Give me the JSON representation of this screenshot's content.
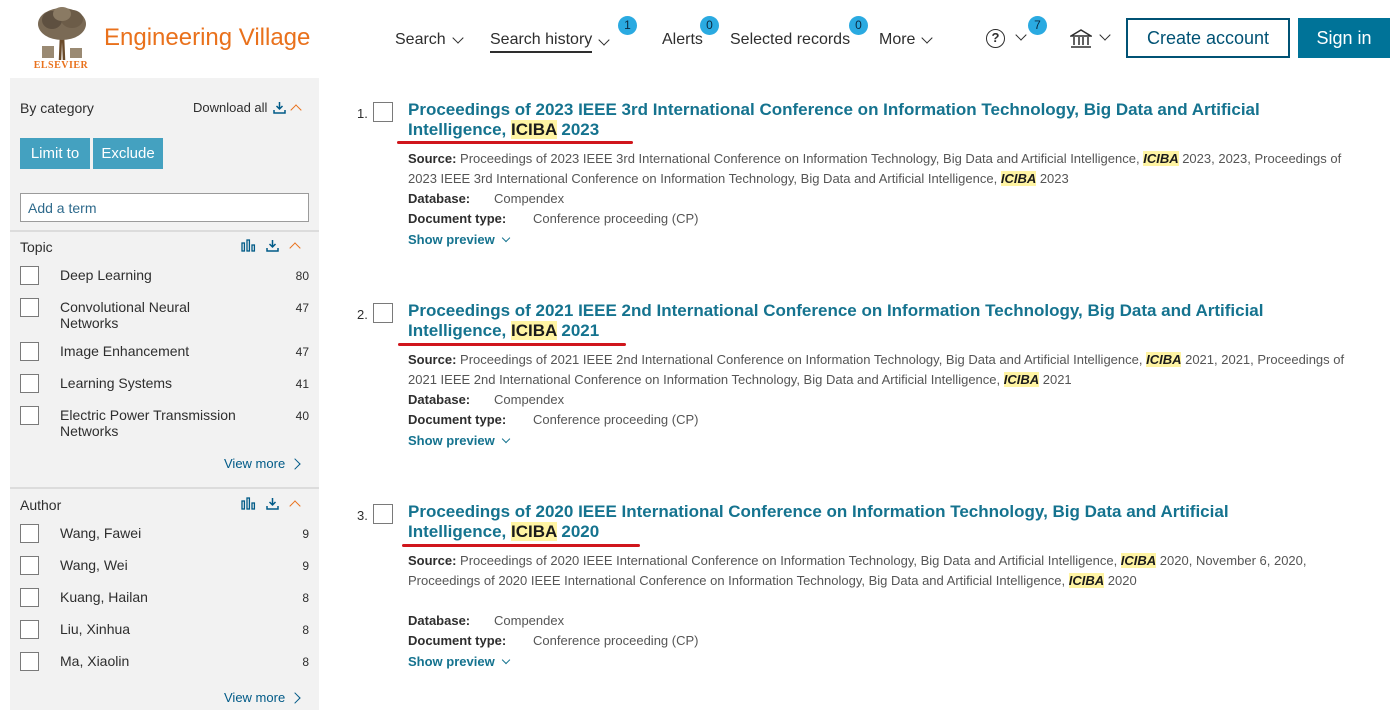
{
  "header": {
    "publisher": "ELSEVIER",
    "brand": "Engineering Village",
    "nav": {
      "search": "Search",
      "search_history": "Search history",
      "search_history_badge": "1",
      "alerts": "Alerts",
      "alerts_badge": "0",
      "selected_records": "Selected records",
      "selected_records_badge": "0",
      "more": "More",
      "help_badge": "7",
      "help_glyph": "?"
    },
    "create_account": "Create account",
    "sign_in": "Sign in"
  },
  "sidebar": {
    "by_category": "By category",
    "download_all": "Download all",
    "limit_to": "Limit to",
    "exclude": "Exclude",
    "add_term_placeholder": "Add a term",
    "topic": {
      "title": "Topic",
      "items": [
        {
          "label": "Deep Learning",
          "count": "80"
        },
        {
          "label": "Convolutional Neural Networks",
          "count": "47"
        },
        {
          "label": "Image Enhancement",
          "count": "47"
        },
        {
          "label": "Learning Systems",
          "count": "41"
        },
        {
          "label": "Electric Power Transmission Networks",
          "count": "40"
        }
      ],
      "view_more": "View more"
    },
    "author": {
      "title": "Author",
      "items": [
        {
          "label": "Wang, Fawei",
          "count": "9"
        },
        {
          "label": "Wang, Wei",
          "count": "9"
        },
        {
          "label": "Kuang, Hailan",
          "count": "8"
        },
        {
          "label": "Liu, Xinhua",
          "count": "8"
        },
        {
          "label": "Ma, Xiaolin",
          "count": "8"
        }
      ],
      "view_more": "View more"
    }
  },
  "results": [
    {
      "num": "1.",
      "title_pre": "Proceedings of 2023 IEEE 3rd International Conference on Information Technology, Big Data and Artificial Intelligence, ",
      "title_hl": "ICIBA",
      "title_post": " 2023",
      "source_label": "Source:",
      "source_a": "Proceedings of 2023 IEEE 3rd International Conference on Information Technology, Big Data and Artificial Intelligence, ",
      "source_hl1": "ICIBA",
      "source_b": " 2023, 2023, Proceedings of 2023 IEEE 3rd International Conference on Information Technology, Big Data and Artificial Intelligence, ",
      "source_hl2": "ICIBA",
      "source_c": " 2023",
      "database_label": "Database:",
      "database": "Compendex",
      "doctype_label": "Document type:",
      "doctype": "Conference proceeding (CP)",
      "show_preview": "Show preview"
    },
    {
      "num": "2.",
      "title_pre": "Proceedings of 2021 IEEE 2nd International Conference on Information Technology, Big Data and Artificial Intelligence, ",
      "title_hl": "ICIBA",
      "title_post": " 2021",
      "source_label": "Source:",
      "source_a": "Proceedings of 2021 IEEE 2nd International Conference on Information Technology, Big Data and Artificial Intelligence, ",
      "source_hl1": "ICIBA",
      "source_b": " 2021, 2021, Proceedings of 2021 IEEE 2nd International Conference on Information Technology, Big Data and Artificial Intelligence, ",
      "source_hl2": "ICIBA",
      "source_c": " 2021",
      "database_label": "Database:",
      "database": "Compendex",
      "doctype_label": "Document type:",
      "doctype": "Conference proceeding (CP)",
      "show_preview": "Show preview"
    },
    {
      "num": "3.",
      "title_pre": "Proceedings of 2020 IEEE International Conference on Information Technology, Big Data and Artificial Intelligence, ",
      "title_hl": "ICIBA",
      "title_post": " 2020",
      "source_label": "Source:",
      "source_a": "Proceedings of 2020 IEEE International Conference on Information Technology, Big Data and Artificial Intelligence, ",
      "source_hl1": "ICIBA",
      "source_b": " 2020, November 6, 2020, Proceedings of 2020 IEEE International Conference on Information Technology, Big Data and Artificial Intelligence, ",
      "source_hl2": "ICIBA",
      "source_c": " 2020",
      "database_label": "Database:",
      "database": "Compendex",
      "doctype_label": "Document type:",
      "doctype": "Conference proceeding (CP)",
      "show_preview": "Show preview"
    }
  ],
  "colors": {
    "brand_orange": "#e9711c",
    "link_teal": "#15738f",
    "badge_blue": "#2aaae1",
    "button_blue": "#44a1c0",
    "annotation_red": "#d0161c"
  }
}
